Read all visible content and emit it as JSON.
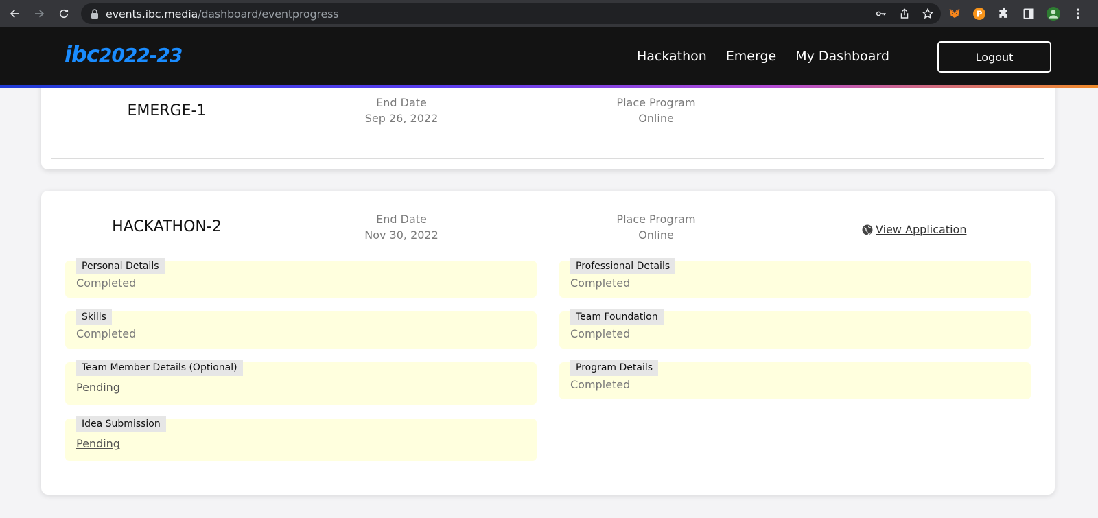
{
  "browser": {
    "url_domain": "events.ibc.media",
    "url_path": "/dashboard/eventprogress"
  },
  "header": {
    "logo_ibc": "ibc",
    "logo_year": "2022-23",
    "nav": [
      "Hackathon",
      "Emerge",
      "My Dashboard"
    ],
    "logout_label": "Logout"
  },
  "events": [
    {
      "name": "EMERGE-1",
      "end_label": "End Date",
      "end_value": "Sep 26, 2022",
      "place_label": "Place Program",
      "place_value": "Online"
    },
    {
      "name": "HACKATHON-2",
      "end_label": "End Date",
      "end_value": "Nov 30, 2022",
      "place_label": "Place Program",
      "place_value": "Online",
      "view_application_label": "View Application",
      "steps_left": [
        {
          "title": "Personal Details",
          "status": "Completed"
        },
        {
          "title": "Skills",
          "status": "Completed"
        },
        {
          "title": "Team Member Details (Optional)",
          "status": "Pending"
        },
        {
          "title": "Idea Submission",
          "status": "Pending"
        }
      ],
      "steps_right": [
        {
          "title": "Professional Details",
          "status": "Completed"
        },
        {
          "title": "Team Foundation",
          "status": "Completed"
        },
        {
          "title": "Program Details",
          "status": "Completed"
        }
      ]
    }
  ],
  "colors": {
    "step_bg": "#ffffde",
    "header_bg": "#131313",
    "accent_blue": "#1a8cff",
    "gradient_end": "#f08a2a"
  }
}
